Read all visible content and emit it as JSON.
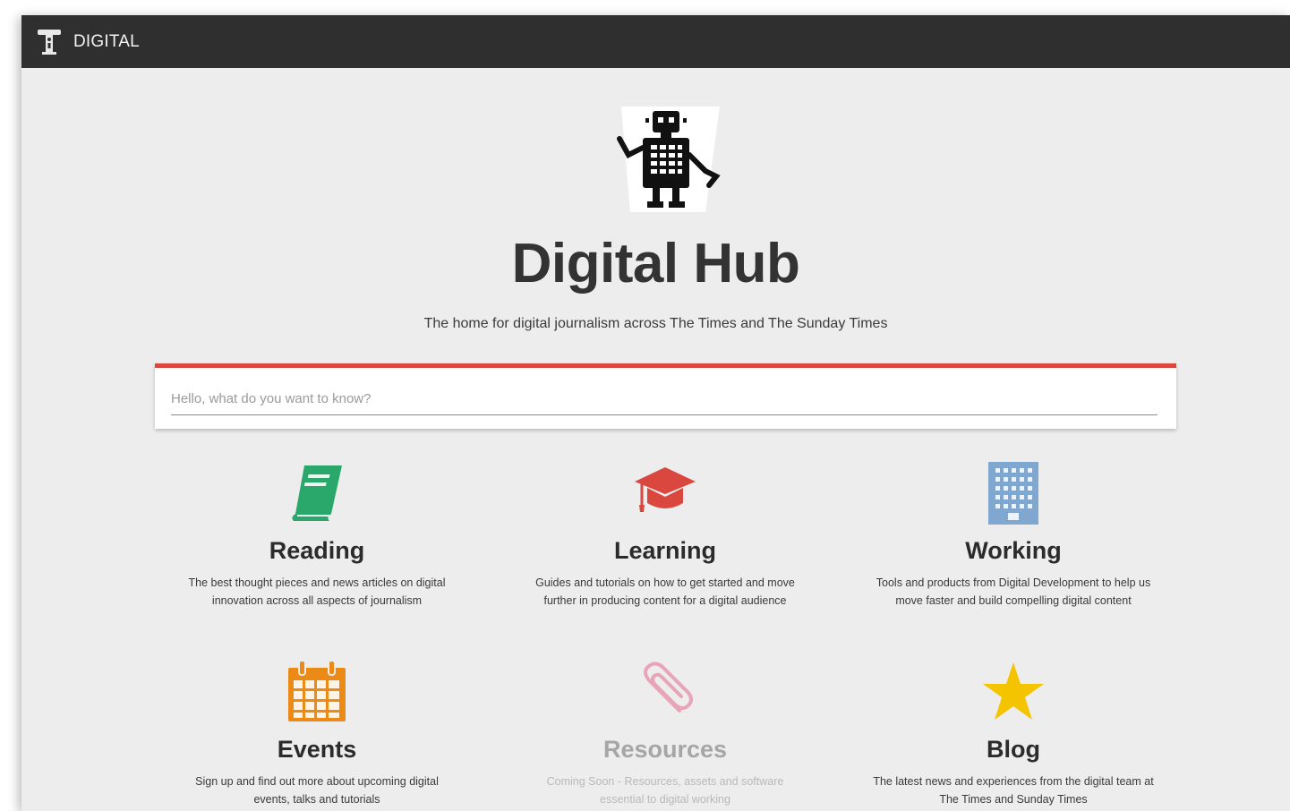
{
  "topbar": {
    "brand": "DIGITAL"
  },
  "hero": {
    "title": "Digital Hub",
    "subtitle": "The home for digital journalism across The Times and The Sunday Times"
  },
  "search": {
    "placeholder": "Hello, what do you want to know?",
    "accent_color": "#d9473e"
  },
  "tiles": [
    {
      "title": "Reading",
      "description": "The best thought pieces and news articles on digital innovation across all aspects of journalism",
      "icon": "book-icon",
      "color": "#2aa86b"
    },
    {
      "title": "Learning",
      "description": "Guides and tutorials on how to get started and move further in producing content for a digital audience",
      "icon": "graduation-cap-icon",
      "color": "#d9473e"
    },
    {
      "title": "Working",
      "description": "Tools and products from Digital Development to help us move faster and build compelling digital content",
      "icon": "office-building-icon",
      "color": "#7fa7d0"
    },
    {
      "title": "Events",
      "description": "Sign up and find out more about upcoming digital events, talks and tutorials",
      "icon": "calendar-icon",
      "color": "#ec8a17"
    },
    {
      "title": "Resources",
      "description": "Coming Soon - Resources, assets and software essential to digital working",
      "icon": "paperclip-icon",
      "color": "#e9a4b9",
      "disabled": true
    },
    {
      "title": "Blog",
      "description": "The latest news and experiences from the digital team at The Times and Sunday Times",
      "icon": "star-icon",
      "color": "#f5c400"
    }
  ]
}
